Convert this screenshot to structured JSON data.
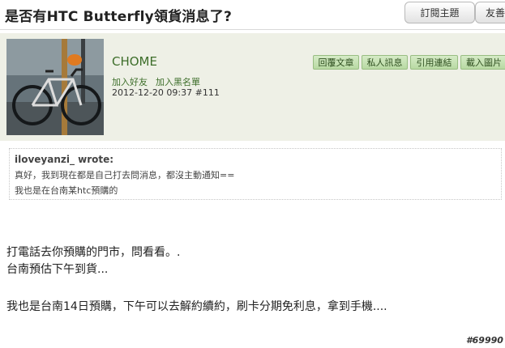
{
  "topic": {
    "title": "是否有HTC Butterfly領貨消息了?"
  },
  "top_actions": {
    "subscribe_label": "訂閱主題",
    "share_label": "友善"
  },
  "post": {
    "author": "CHOME",
    "add_friend_label": "加入好友",
    "block_label": "加入黑名單",
    "date": "2012-12-20 09:37",
    "post_number": "#111",
    "actions": {
      "reply_label": "回覆文章",
      "pm_label": "私人訊息",
      "link_label": "引用連結",
      "image_label": "載入圖片"
    },
    "quote": {
      "author_line": "iloveyanzi_ wrote:",
      "lines": [
        "真好，我到現在都是自己打去問消息，都沒主動通知==",
        "我也是在台南某htc預購的"
      ]
    },
    "body_lines": [
      "打電話去你預購的門市，問看看。.",
      "台南預估下午到貨...",
      "我也是台南14日預購，下午可以去解約續約，刷卡分期免利息，拿到手機...."
    ],
    "floor_id": "#69990"
  },
  "colors": {
    "card_background": "#eef0e6",
    "author_green": "#3d6e2a",
    "button_green": "#b8d9a3"
  }
}
